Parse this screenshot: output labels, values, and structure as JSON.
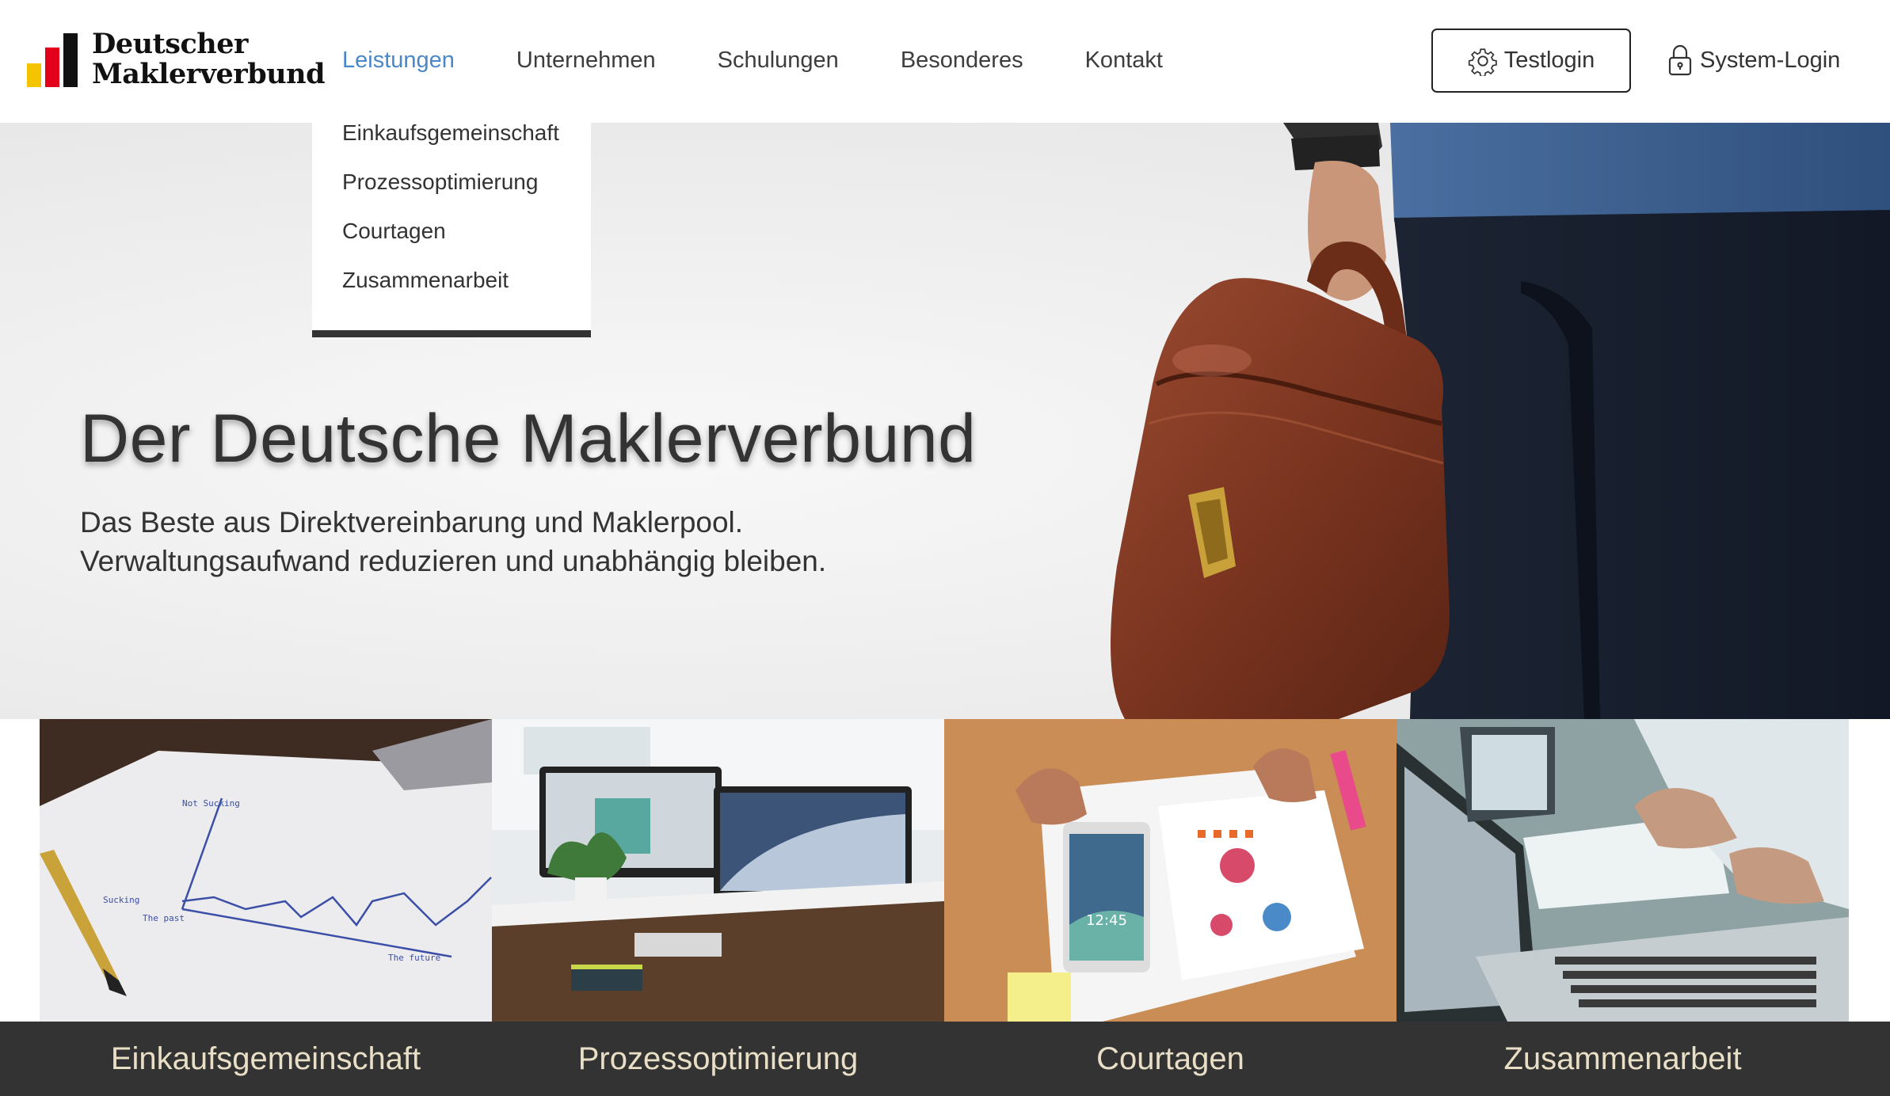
{
  "brand": {
    "line1": "Deutscher",
    "line2": "Maklerverbund",
    "bar_colors": [
      "#f5c400",
      "#e2001a",
      "#111111"
    ]
  },
  "nav": {
    "items": [
      {
        "label": "Leistungen",
        "active": true
      },
      {
        "label": "Unternehmen"
      },
      {
        "label": "Schulungen"
      },
      {
        "label": "Besonderes"
      },
      {
        "label": "Kontakt"
      }
    ],
    "active_color": "#4a87c8"
  },
  "actions": {
    "testlogin": {
      "label": "Testlogin",
      "icon": "gear-icon"
    },
    "system_login": {
      "label": "System-Login",
      "icon": "lock-icon"
    }
  },
  "dropdown": {
    "items": [
      "Einkaufsgemeinschaft",
      "Prozessoptimierung",
      "Courtagen",
      "Zusammenarbeit"
    ]
  },
  "hero": {
    "title": "Der Deutsche Maklerverbund",
    "subtitle_line1": "Das Beste aus Direktvereinbarung und Maklerpool.",
    "subtitle_line2": "Verwaltungsaufwand reduzieren und unabhängig bleiben."
  },
  "tiles": [
    {
      "caption": "Einkaufsgemeinschaft",
      "image": "notebook-chart-photo",
      "sketch": {
        "top_label": "Not Sucking",
        "left_label": "Sucking",
        "bottom_left": "The past",
        "bottom_right": "The future"
      }
    },
    {
      "caption": "Prozessoptimierung",
      "image": "desk-monitors-photo"
    },
    {
      "caption": "Courtagen",
      "image": "tablet-charts-photo",
      "tablet_time": "12:45"
    },
    {
      "caption": "Zusammenarbeit",
      "image": "laptop-teamwork-photo"
    }
  ],
  "colors": {
    "caption_bg": "#333333",
    "caption_text": "#e8dfc6",
    "dropdown_border": "#333333"
  }
}
